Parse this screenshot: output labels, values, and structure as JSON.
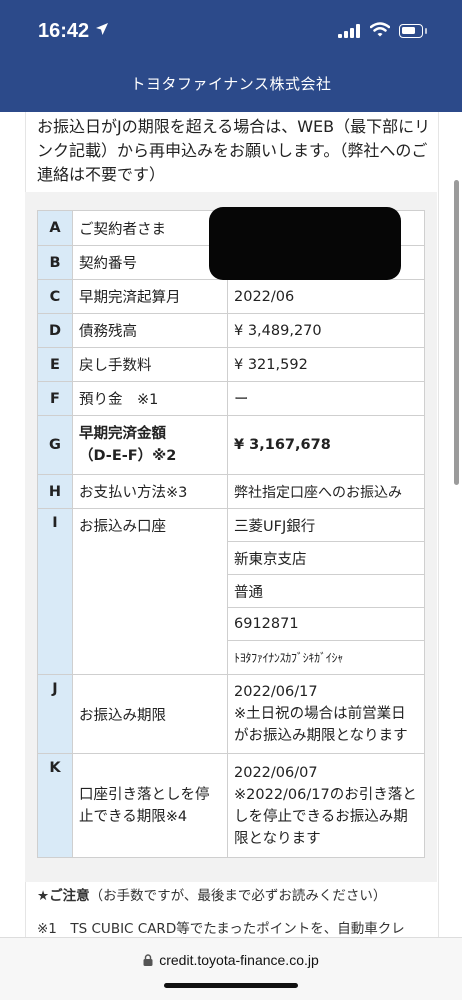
{
  "status": {
    "time": "16:42"
  },
  "header": {
    "title": "トヨタファイナンス株式会社"
  },
  "intro": "お振込日がJの期限を超える場合は、WEB（最下部にリンク記載）から再申込みをお願いします。（弊社へのご連絡は不要です）",
  "rows": [
    {
      "letter": "A",
      "label": "ご契約者さま",
      "value": ""
    },
    {
      "letter": "B",
      "label": "契約番号",
      "value": ""
    },
    {
      "letter": "C",
      "label": "早期完済起算月",
      "value": "2022/06"
    },
    {
      "letter": "D",
      "label": "債務残高",
      "value": "¥ 3,489,270"
    },
    {
      "letter": "E",
      "label": "戻し手数料",
      "value": "¥ 321,592"
    },
    {
      "letter": "F",
      "label": "預り金　※1",
      "value": "ー"
    },
    {
      "letter": "G",
      "label_line1": "早期完済金額",
      "label_line2": "（D-E-F）※2",
      "value": "¥ 3,167,678"
    },
    {
      "letter": "H",
      "label": "お支払い方法※3",
      "value": "弊社指定口座へのお振込み"
    },
    {
      "letter": "I",
      "label": "お振込み口座",
      "values": [
        "三菱UFJ銀行",
        "新東京支店",
        "普通",
        "6912871",
        "ﾄﾖﾀﾌｧｲﾅﾝｽｶﾌﾞｼｷｶﾞｲｼｬ"
      ]
    },
    {
      "letter": "J",
      "label": "お振込み期限",
      "value_line1": "2022/06/17",
      "value_line2": "※土日祝の場合は前営業日がお振込み期限となります"
    },
    {
      "letter": "K",
      "label": "口座引き落としを停止できる期限※4",
      "value_line1": "2022/06/07",
      "value_line2": "※2022/06/17のお引き落としを停止できるお振込み期限となります"
    }
  ],
  "notice": {
    "title": "★ご注意",
    "text": "（お手数ですが、最後まで必ずお読みください）"
  },
  "footnote": "※1　TS CUBIC CARD等でたまったポイントを、自動車クレ",
  "urlbar": {
    "url": "credit.toyota-finance.co.jp"
  },
  "colors": {
    "header_bg": "#2c4a8a",
    "letter_cell_bg": "#d9eaf7",
    "panel_bg": "#f2f2f2"
  }
}
